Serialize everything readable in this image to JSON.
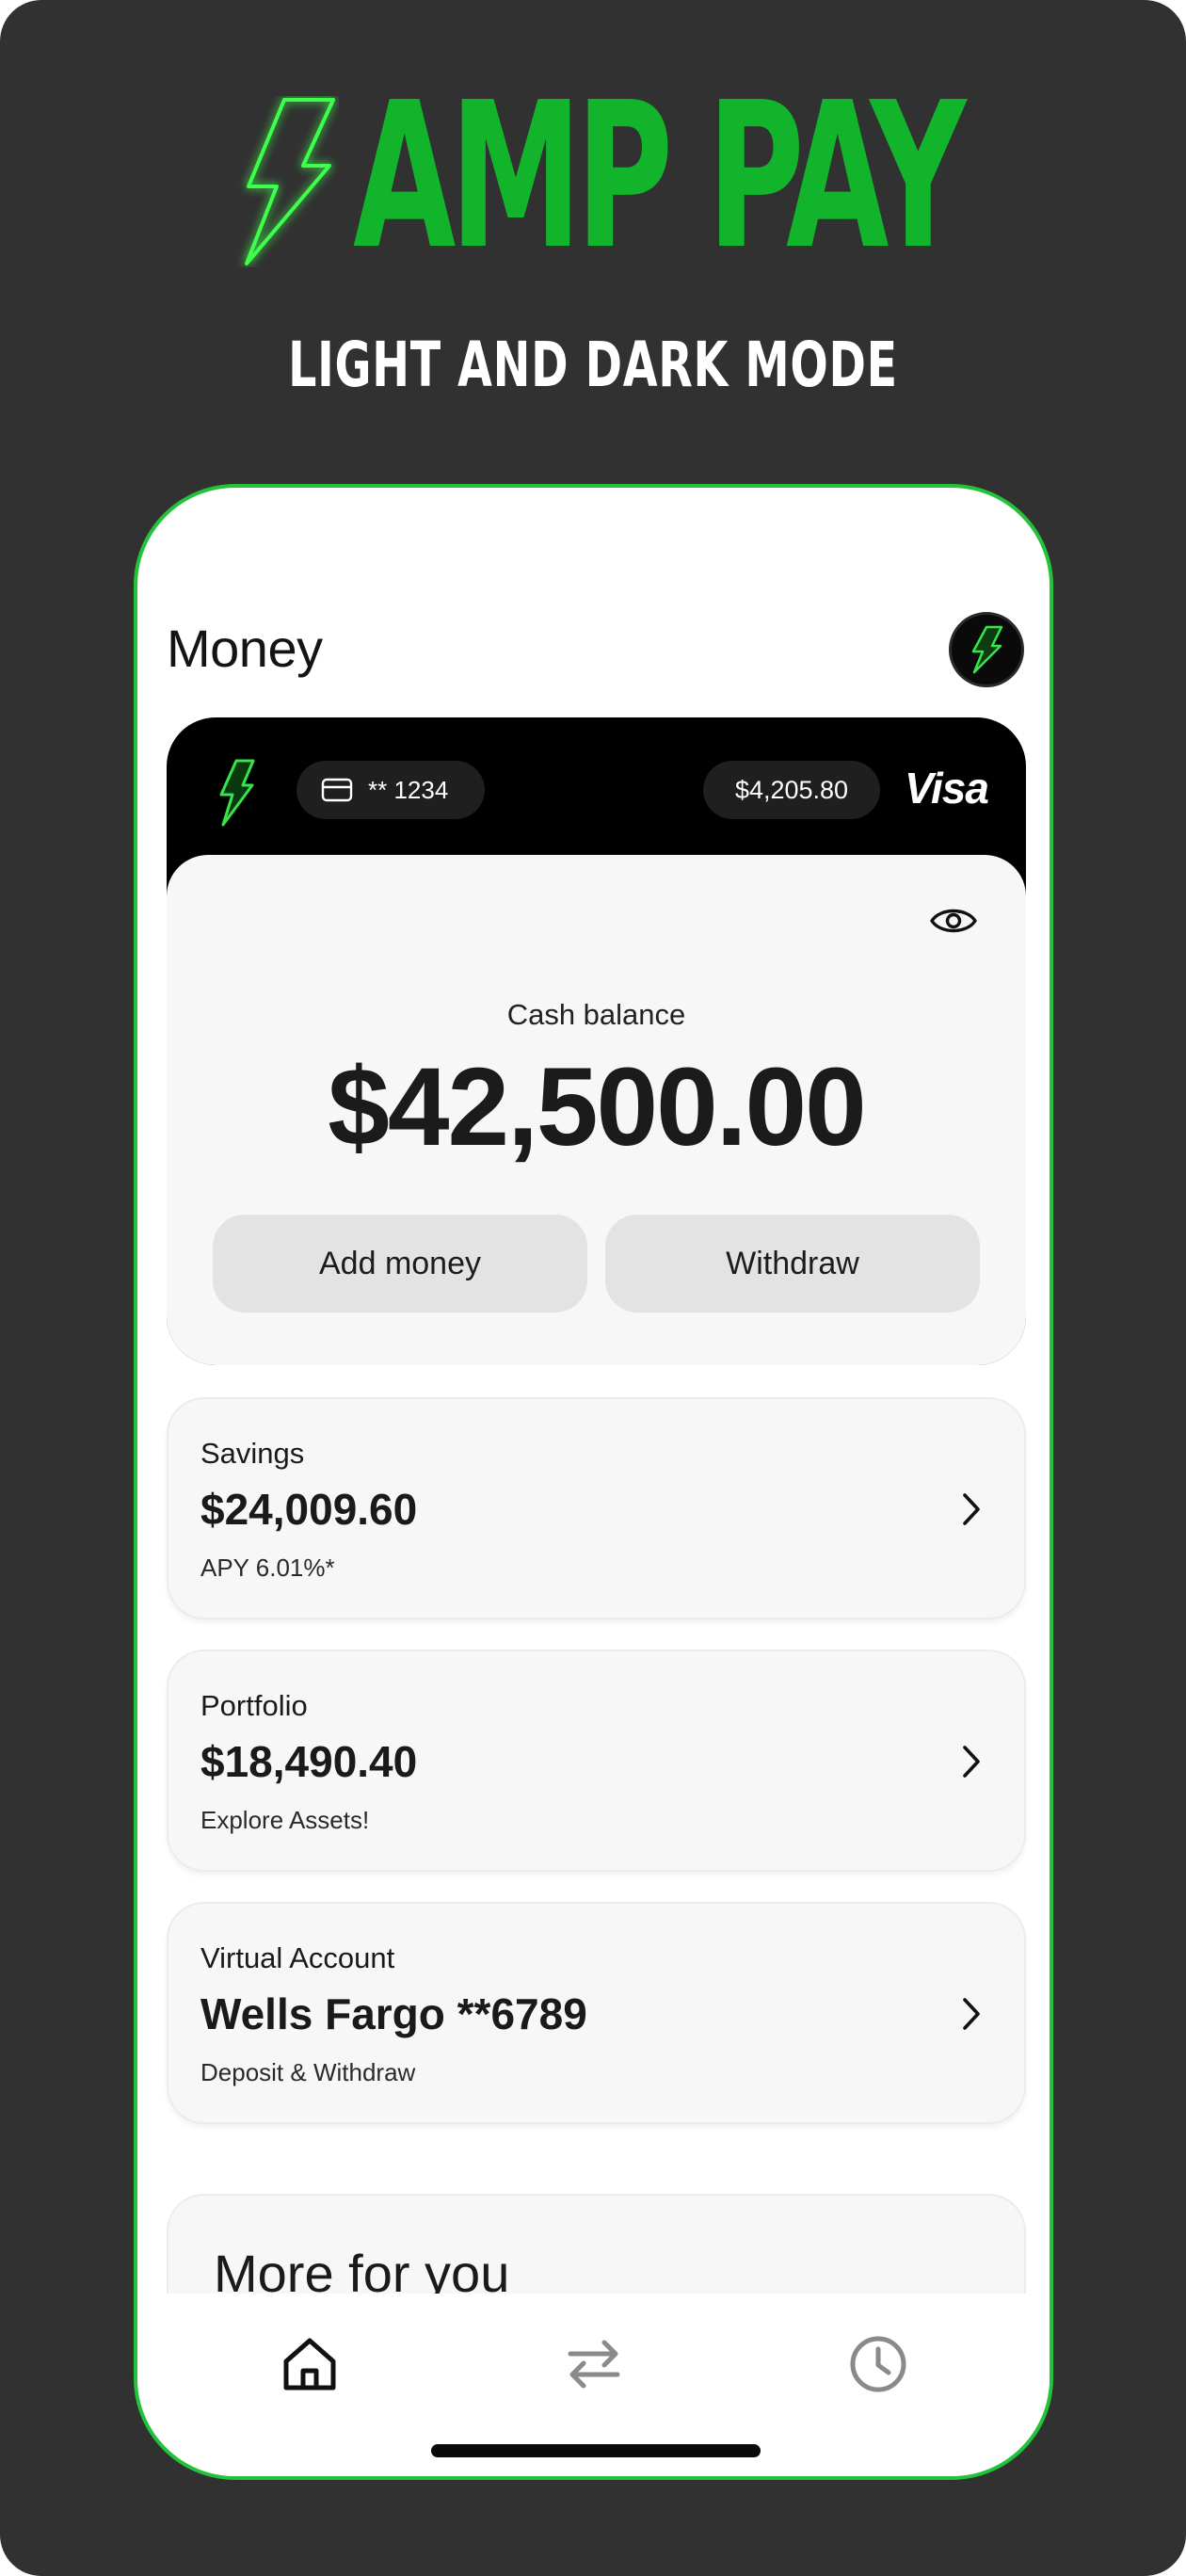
{
  "hero": {
    "title": "AMP PAY",
    "subtitle": "LIGHT AND DARK MODE",
    "logo_icon": "lightning-bolt-icon",
    "brand_color": "#11b42a"
  },
  "header": {
    "title": "Money",
    "profile_icon": "lightning-bolt-icon"
  },
  "card": {
    "number_masked": "** 1234",
    "balance": "$4,205.80",
    "network": "Visa"
  },
  "cash": {
    "label": "Cash balance",
    "amount": "$42,500.00",
    "add_label": "Add money",
    "withdraw_label": "Withdraw",
    "visibility_icon": "eye-icon"
  },
  "accounts": [
    {
      "label": "Savings",
      "amount": "$24,009.60",
      "sub": "APY 6.01%*"
    },
    {
      "label": "Portfolio",
      "amount": "$18,490.40",
      "sub": "Explore Assets!"
    },
    {
      "label": "Virtual Account",
      "amount": "Wells Fargo **6789",
      "sub": "Deposit & Withdraw"
    }
  ],
  "more": {
    "title": "More for you"
  },
  "nav": {
    "items": [
      "home-icon",
      "transfer-icon",
      "clock-icon"
    ]
  }
}
